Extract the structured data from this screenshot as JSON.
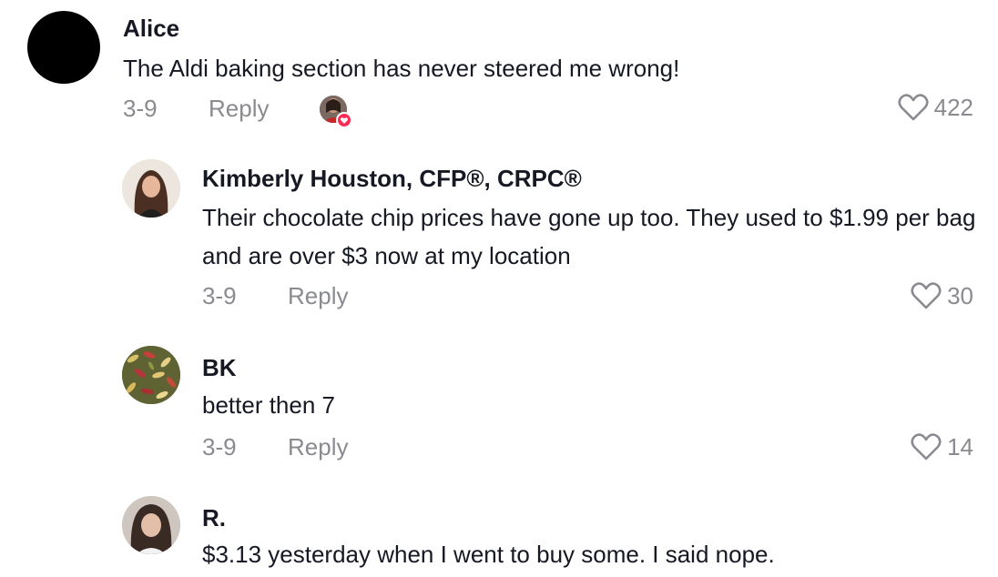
{
  "comments": [
    {
      "author": "Alice",
      "text": "The Aldi baking section has never steered me wrong!",
      "date": "3-9",
      "reply_label": "Reply",
      "likes": "422",
      "creator_liked": true
    },
    {
      "author": "Kimberly Houston, CFP®, CRPC®",
      "text": "Their chocolate chip prices have gone up too. They used to $1.99 per bag and are over $3 now at my location",
      "date": "3-9",
      "reply_label": "Reply",
      "likes": "30"
    },
    {
      "author": "BK",
      "text": "better then 7",
      "date": "3-9",
      "reply_label": "Reply",
      "likes": "14"
    },
    {
      "author": "R.",
      "text": "$3.13 yesterday when I went to buy some. I said nope."
    }
  ],
  "colors": {
    "text": "#161823",
    "muted": "#8a8b91",
    "creator_badge": "#fe2c55"
  },
  "icons": {
    "like": "heart-outline-icon",
    "creator_liked": "creator-liked-heart-icon"
  }
}
